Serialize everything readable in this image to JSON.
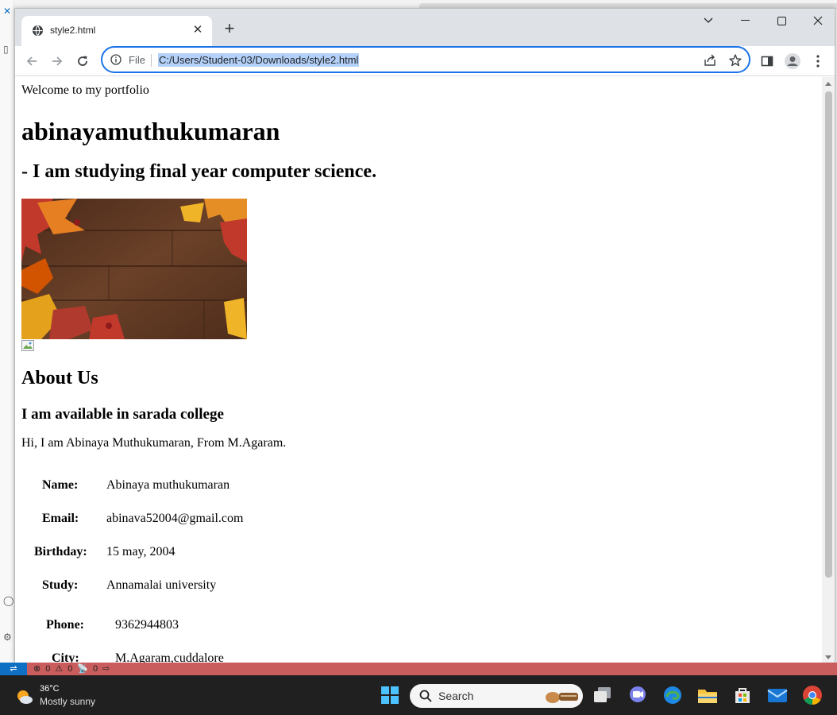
{
  "browser": {
    "tab_title": "style2.html",
    "omnibox_scheme": "File",
    "url": "C:/Users/Student-03/Downloads/style2.html"
  },
  "page": {
    "welcome": "Welcome to my portfolio",
    "name": "abinayamuthukumaran",
    "study_line": "- I am studying final year computer science.",
    "about_heading": "About Us",
    "availability": "I am available in sarada college",
    "intro": "Hi, I am Abinaya Muthukumaran, From M.Agaram.",
    "details": [
      {
        "label": "Name:",
        "value": "Abinaya muthukumaran"
      },
      {
        "label": "Email:",
        "value": "abinava52004@gmail.com"
      },
      {
        "label": "Birthday:",
        "value": "15 may, 2004"
      },
      {
        "label": "Study:",
        "value": "Annamalai university"
      },
      {
        "label": "Phone:",
        "value": "9362944803"
      },
      {
        "label": "City:",
        "value": "M.Agaram,cuddalore"
      }
    ]
  },
  "statusbar": {
    "errors": "0",
    "warnings": "0",
    "ports": "0"
  },
  "taskbar": {
    "temperature": "36°C",
    "condition": "Mostly sunny",
    "search_placeholder": "Search"
  },
  "colors": {
    "accent": "#1a73e8",
    "url_highlight": "#b3d1f9",
    "statusbar": "#c95d5d",
    "taskbar": "#202020"
  }
}
